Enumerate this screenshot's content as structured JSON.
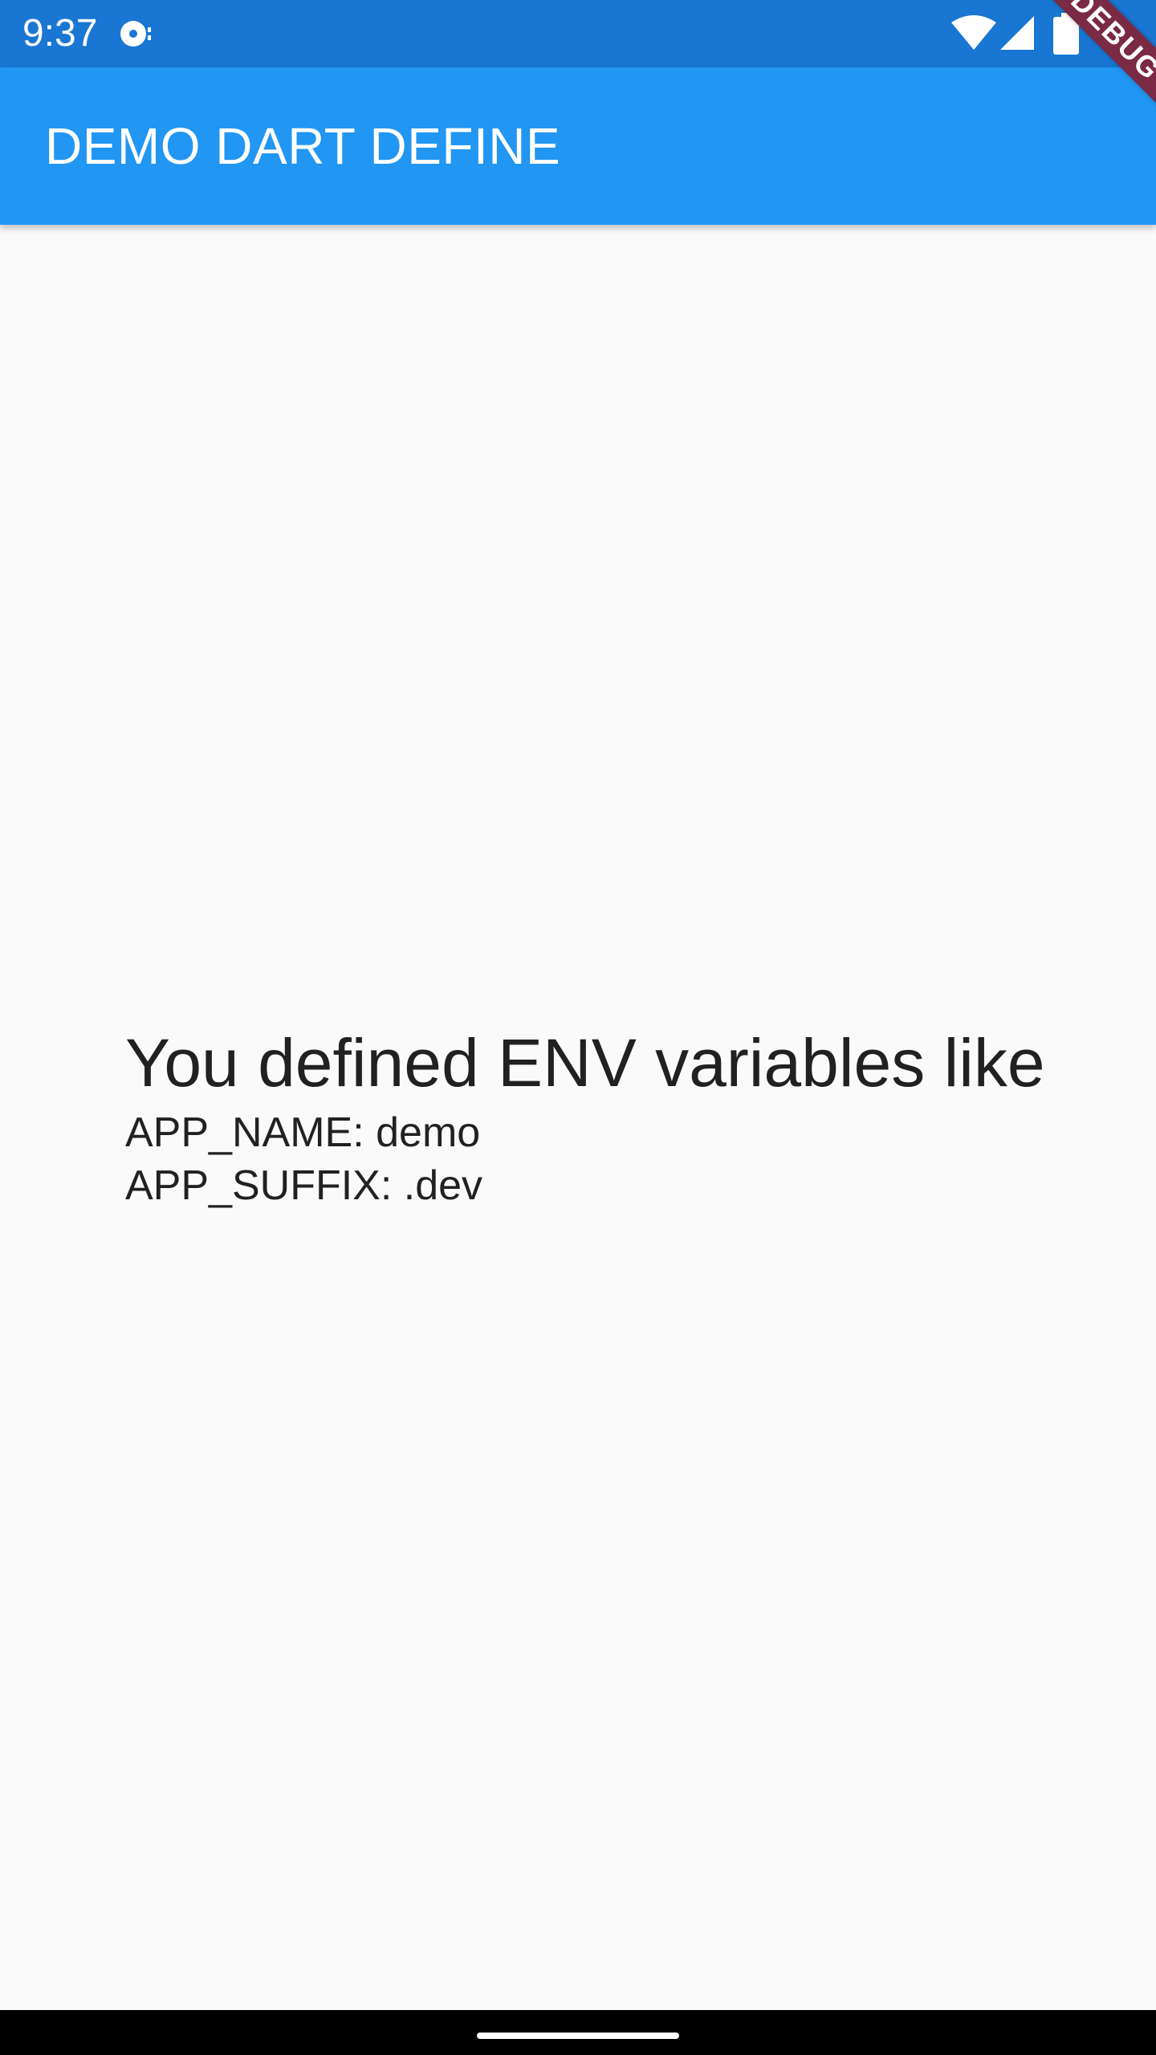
{
  "status_bar": {
    "time": "9:37",
    "icons": [
      "media-icon",
      "wifi-icon",
      "signal-icon",
      "battery-icon"
    ]
  },
  "app_bar": {
    "title": "DEMO DART DEFINE",
    "color": "#2196f3"
  },
  "debug_banner": {
    "label": "DEBUG",
    "color": "#7a2a44"
  },
  "content": {
    "headline": "You defined ENV variables like",
    "lines": [
      "APP_NAME: demo",
      "APP_SUFFIX: .dev"
    ]
  },
  "colors": {
    "status_bar": "#1976d2",
    "background": "#fafafa",
    "text": "#212121"
  }
}
